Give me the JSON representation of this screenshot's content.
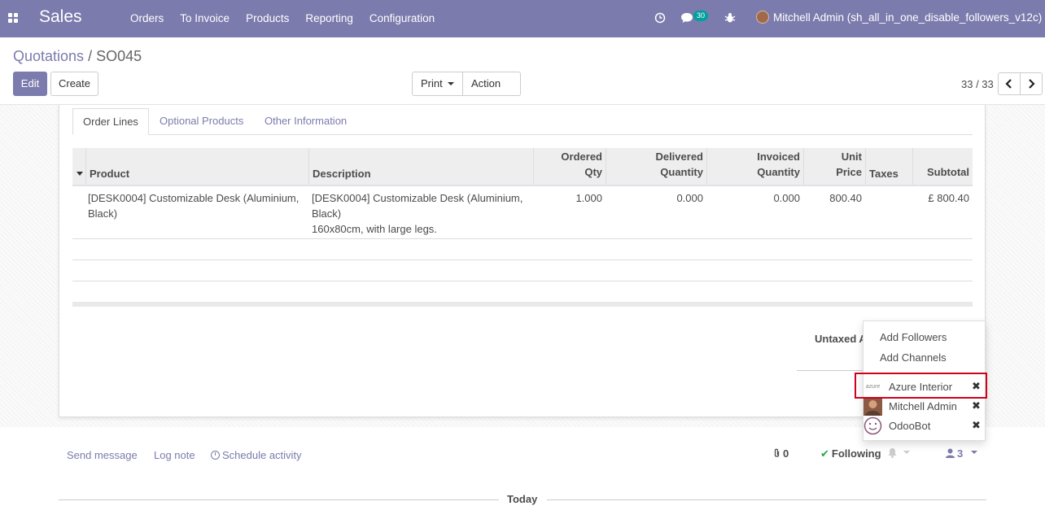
{
  "navbar": {
    "app_name": "Sales",
    "menu": [
      "Orders",
      "To Invoice",
      "Products",
      "Reporting",
      "Configuration"
    ],
    "message_count": "30",
    "user_name": "Mitchell Admin (sh_all_in_one_disable_followers_v12c)",
    "color": "#7c7bad"
  },
  "breadcrumb": {
    "parent": "Quotations",
    "separator": "/",
    "current": "SO045"
  },
  "buttons": {
    "edit": "Edit",
    "create": "Create",
    "print": "Print",
    "action": "Action"
  },
  "pager": {
    "value": "33 / 33"
  },
  "tabs": [
    "Order Lines",
    "Optional Products",
    "Other Information"
  ],
  "table": {
    "headers": {
      "product": "Product",
      "description": "Description",
      "ordered_qty_1": "Ordered",
      "ordered_qty_2": "Qty",
      "delivered_1": "Delivered",
      "delivered_2": "Quantity",
      "invoiced_1": "Invoiced",
      "invoiced_2": "Quantity",
      "unit_price_1": "Unit",
      "unit_price_2": "Price",
      "taxes": "Taxes",
      "subtotal": "Subtotal"
    },
    "rows": [
      {
        "product_1": "[DESK0004] Customizable Desk (Aluminium,",
        "product_2": "Black)",
        "description_1": "[DESK0004] Customizable Desk (Aluminium,",
        "description_2": "Black)",
        "description_3": "160x80cm, with large legs.",
        "ordered_qty": "1.000",
        "delivered": "0.000",
        "invoiced": "0.000",
        "unit_price": "800.40",
        "taxes": "",
        "subtotal": "£ 800.40"
      }
    ]
  },
  "totals": {
    "untaxed_label": "Untaxed A"
  },
  "chatter": {
    "send_message": "Send message",
    "log_note": "Log note",
    "schedule_activity": "Schedule activity",
    "attachments": "0",
    "following": "Following",
    "followers_count": "3",
    "today": "Today"
  },
  "followers_dropdown": {
    "add_followers": "Add Followers",
    "add_channels": "Add Channels",
    "followers": [
      {
        "name": "Azure Interior",
        "icon": "azure-logo",
        "logo_text": "azure"
      },
      {
        "name": "Mitchell Admin",
        "icon": "user-photo"
      },
      {
        "name": "OdooBot",
        "icon": "odoobot-avatar"
      }
    ],
    "remove_glyph": "✖"
  }
}
